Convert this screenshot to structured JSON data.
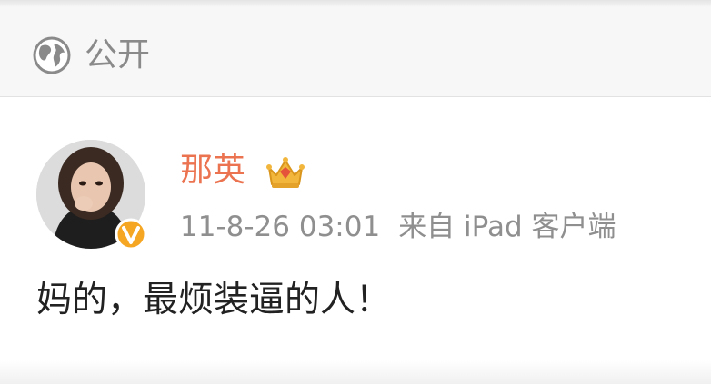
{
  "visibility": {
    "label": "公开",
    "icon": "globe-icon"
  },
  "post": {
    "author": {
      "name": "那英",
      "badge_icon": "crown-icon",
      "verified_icon": "verified-v-icon"
    },
    "timestamp": "11-8-26 03:01",
    "source": "来自 iPad 客户端",
    "text": "妈的，最烦装逼的人！"
  },
  "colors": {
    "username": "#eb7350",
    "meta": "#8f8f8f",
    "verified_badge": "#f5a623",
    "crown": "#f2b63c"
  }
}
